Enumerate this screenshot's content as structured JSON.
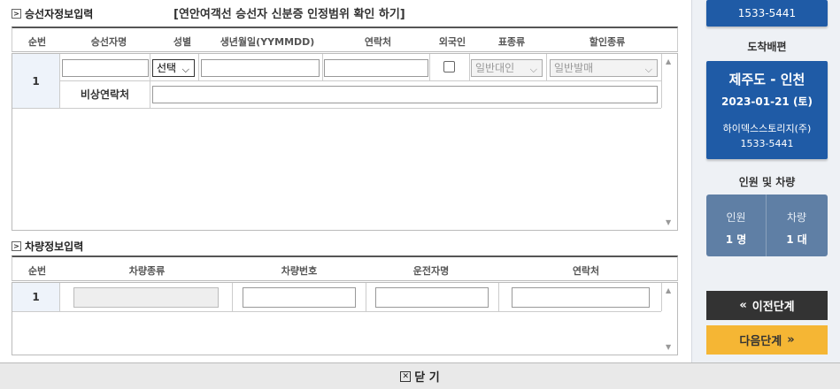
{
  "passenger_section": {
    "title": "승선자정보입력",
    "notice": "[연안여객선 승선자 신분증 인정범위 확인 하기]",
    "columns": [
      "순번",
      "승선자명",
      "성별",
      "생년월일(YYMMDD)",
      "연락처",
      "외국인",
      "표종류",
      "할인종류"
    ],
    "rows": [
      {
        "no": "1",
        "name": "",
        "gender": "선택",
        "birthdate": "",
        "phone": "",
        "foreigner": false,
        "ticket_type": "일반대인",
        "discount_type": "일반발매",
        "emergency_label": "비상연락처",
        "emergency_contact": ""
      }
    ]
  },
  "vehicle_section": {
    "title": "차량정보입력",
    "columns": [
      "순번",
      "차량종류",
      "차량번호",
      "운전자명",
      "연락처"
    ],
    "rows": [
      {
        "no": "1",
        "vehicle_type": "",
        "vehicle_number": "",
        "driver_name": "",
        "phone": ""
      }
    ]
  },
  "sidebar": {
    "top_card": {
      "line1": "1533-5441"
    },
    "arrival_label": "도착배편",
    "arrival_card": {
      "route": "제주도 - 인천",
      "date": "2023-01-21 (토)",
      "company": "하이덱스스토리지(주)",
      "phone": "1533-5441"
    },
    "people_label": "인원 및 차량",
    "people": {
      "persons_label": "인원",
      "persons_value": "1 명",
      "vehicles_label": "차량",
      "vehicles_value": "1 대"
    },
    "prev_button": "이전단계",
    "next_button": "다음단계",
    "colors": {
      "card": "#1f5ba6",
      "next": "#f5b634",
      "prev": "#333333"
    }
  },
  "footer": {
    "close_label": "닫 기"
  }
}
